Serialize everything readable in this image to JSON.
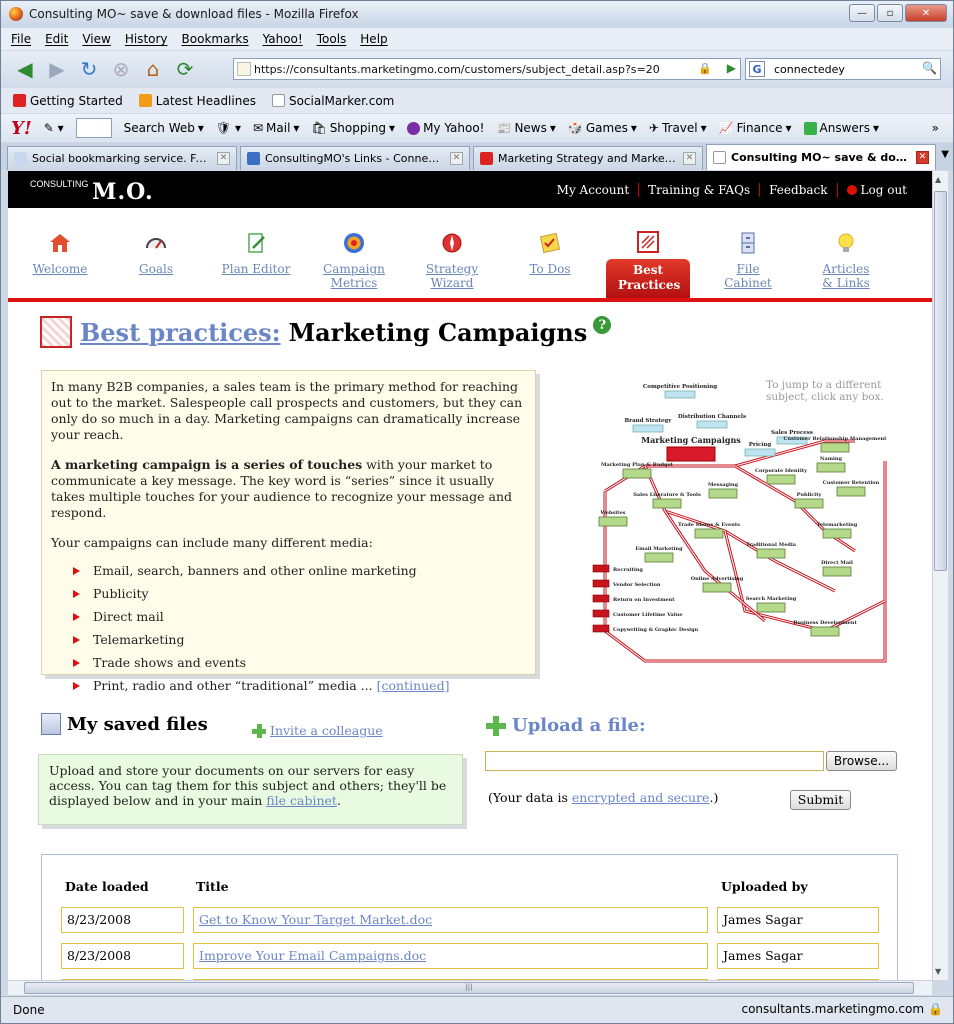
{
  "window": {
    "title": "Consulting MO~ save & download files - Mozilla Firefox"
  },
  "menu": [
    "File",
    "Edit",
    "View",
    "History",
    "Bookmarks",
    "Yahoo!",
    "Tools",
    "Help"
  ],
  "nav": {
    "url": "https://consultants.marketingmo.com/customers/subject_detail.asp?s=20",
    "search_value": "connectedey"
  },
  "bookmarks": [
    "Getting Started",
    "Latest Headlines",
    "SocialMarker.com"
  ],
  "yahoo": {
    "logo": "Y!",
    "search_web": "Search Web",
    "items": [
      "Mail",
      "Shopping",
      "My Yahoo!",
      "News",
      "Games",
      "Travel",
      "Finance",
      "Answers"
    ],
    "more": "»"
  },
  "tabs": [
    {
      "label": "Social bookmarking service. Fast t..."
    },
    {
      "label": "ConsultingMO's Links - Connecte..."
    },
    {
      "label": "Marketing Strategy and Marketin..."
    },
    {
      "label": "Consulting MO~ save & downlo..."
    }
  ],
  "site": {
    "logo_small": "CONSULTING",
    "logo_big": "M.O.",
    "top_links": [
      "My Account",
      "Training & FAQs",
      "Feedback",
      "Log out"
    ],
    "nav_items": [
      {
        "label": "Welcome",
        "active": false
      },
      {
        "label": "Goals",
        "active": false
      },
      {
        "label": "Plan Editor",
        "active": false
      },
      {
        "label": "Campaign Metrics",
        "active": false
      },
      {
        "label": "Strategy Wizard",
        "active": false
      },
      {
        "label": "To Dos",
        "active": false
      },
      {
        "label": "Best Practices",
        "active": true
      },
      {
        "label": "File Cabinet",
        "active": false
      },
      {
        "label": "Articles & Links",
        "active": false
      }
    ]
  },
  "page": {
    "title_link": "Best practices:",
    "title_rest": "Marketing Campaigns",
    "help": "?",
    "intro_p1": "In many B2B companies, a sales team is the primary method for reaching out to the market. Salespeople call prospects and customers, but they can only do so much in a day. Marketing campaigns can dramatically increase your reach.",
    "intro_p2_bold": "A marketing campaign is a series of touches",
    "intro_p2_rest": " with your market to communicate a key message. The key word is “series” since it usually takes multiple touches for your audience to recognize your message and respond.",
    "intro_p3": "Your campaigns can include many different media:",
    "media": [
      "Email, search, banners and other online marketing",
      "Publicity",
      "Direct mail",
      "Telemarketing",
      "Trade shows and events",
      "Print, radio and other “traditional” media ..."
    ],
    "continued": "[continued]",
    "diagram_hint": "To jump to a different subject, click any box."
  },
  "diagram": {
    "center": "Marketing Campaigns",
    "nodes": [
      "Competitive Positioning",
      "Brand Strategy",
      "Distribution Channels",
      "Pricing",
      "Sales Process",
      "Customer Relationship Management",
      "Marketing Plan & Budget",
      "Corporate Identity",
      "Naming",
      "Customer Retention",
      "Sales Literature & Tools",
      "Messaging",
      "Publicity",
      "Websites",
      "Trade Shows & Events",
      "Telemarketing",
      "Email Marketing",
      "Traditional Media",
      "Direct Mail",
      "Online Advertising",
      "Search Marketing",
      "Business Development"
    ],
    "legend": [
      "Recruiting",
      "Vendor Selection",
      "Return on Investment",
      "Customer Lifetime Value",
      "Copywriting & Graphic Design"
    ]
  },
  "files": {
    "heading": "My saved files",
    "invite": "Invite a colleague",
    "desc": "Upload and store your documents on our servers for easy access. You can tag them for this subject and others; they'll be displayed below and in your main ",
    "desc_link": "file cabinet",
    "desc_end": ".",
    "upload_heading": "Upload a file:",
    "browse": "Browse...",
    "secure_pre": "(Your data is ",
    "secure_link": "encrypted and secure",
    "secure_post": ".)",
    "submit": "Submit",
    "columns": [
      "Date loaded",
      "Title",
      "Uploaded by"
    ],
    "rows": [
      {
        "date": "8/23/2008",
        "title": "Get to Know Your Target Market.doc",
        "by": "James Sagar"
      },
      {
        "date": "8/23/2008",
        "title": "Improve Your Email Campaigns.doc",
        "by": "James Sagar"
      }
    ]
  },
  "status": {
    "left": "Done",
    "host": "consultants.marketingmo.com"
  },
  "colors": {
    "accent_red": "#dd1111",
    "link_blue": "#6a86c8",
    "header_black": "#000000",
    "intro_bg": "#fffdea",
    "saved_bg": "#e8fbe0"
  }
}
